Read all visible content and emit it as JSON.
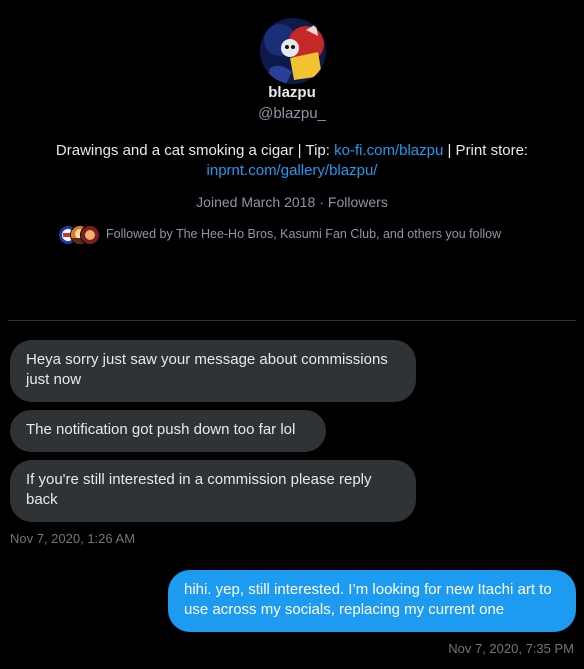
{
  "profile": {
    "display_name": "blazpu",
    "handle": "@blazpu_",
    "bio_text_1": "Drawings and a cat smoking a cigar | Tip: ",
    "bio_link_1": "ko-fi.com/blazpu",
    "bio_text_2": " | Print store: ",
    "bio_link_2": "inprnt.com/gallery/blazpu/",
    "joined": "Joined March 2018",
    "separator": "·",
    "followers_label": "Followers",
    "followed_by": "Followed by The Hee-Ho Bros, Kasumi Fan Club, and others you follow",
    "avatar_icon": "profile-avatar-image"
  },
  "messages": [
    {
      "direction": "received",
      "text": "Heya sorry just saw your message about commissions just now"
    },
    {
      "direction": "received",
      "text": "The notification got push down  too far lol"
    },
    {
      "direction": "received",
      "text": "If you're still interested in a commission please reply back"
    },
    {
      "direction": "sent",
      "text": "hihi. yep, still interested. I’m looking for new Itachi art to use across my socials, replacing my current one"
    }
  ],
  "timestamps": {
    "received_group": "Nov 7, 2020, 1:26 AM",
    "sent_group": "Nov 7, 2020, 7:35 PM"
  },
  "colors": {
    "background": "#000000",
    "received_bubble": "#2f3336",
    "sent_bubble": "#1d9bf0",
    "link": "#1d9bf0",
    "secondary_text": "#8b98a5"
  }
}
